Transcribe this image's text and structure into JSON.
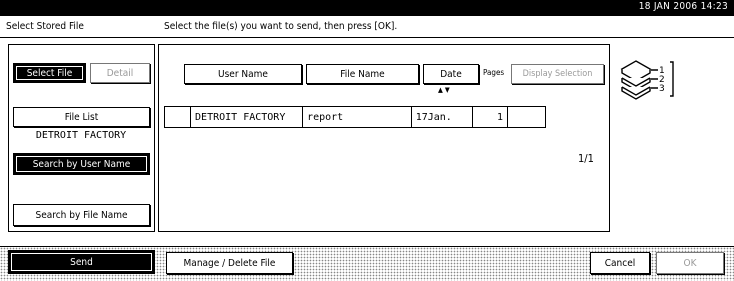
{
  "status_bar": {
    "date": "18  JAN   2006 14:23"
  },
  "header": {
    "title": "Select Stored File",
    "instruction": "Select the file(s) you want to send, then press [OK]."
  },
  "sidebar": {
    "tab_select_file": "Select File",
    "tab_detail": "Detail",
    "file_list_button": "File List",
    "selected_user": "DETROIT FACTORY",
    "search_user_button": "Search by User Name",
    "search_file_button": "Search by File Name"
  },
  "table": {
    "columns": {
      "user_name": "User Name",
      "file_name": "File Name",
      "date": "Date",
      "pages": "Pages",
      "display_selection": "Display Selection"
    },
    "sort_indicator": "▲▼",
    "rows": [
      {
        "user_name": "DETROIT FACTORY",
        "file_name": "report",
        "date": "17Jan.",
        "pages": "1"
      }
    ],
    "page_indicator": "1/1"
  },
  "output_icon": {
    "label_1": "1",
    "label_2": "2",
    "label_3": "3"
  },
  "footer": {
    "send_button": "Send",
    "manage_button": "Manage / Delete File",
    "cancel_button": "Cancel",
    "ok_button": "OK"
  },
  "colors": {
    "background": "#ffffff",
    "foreground": "#000000",
    "disabled": "#999999"
  }
}
